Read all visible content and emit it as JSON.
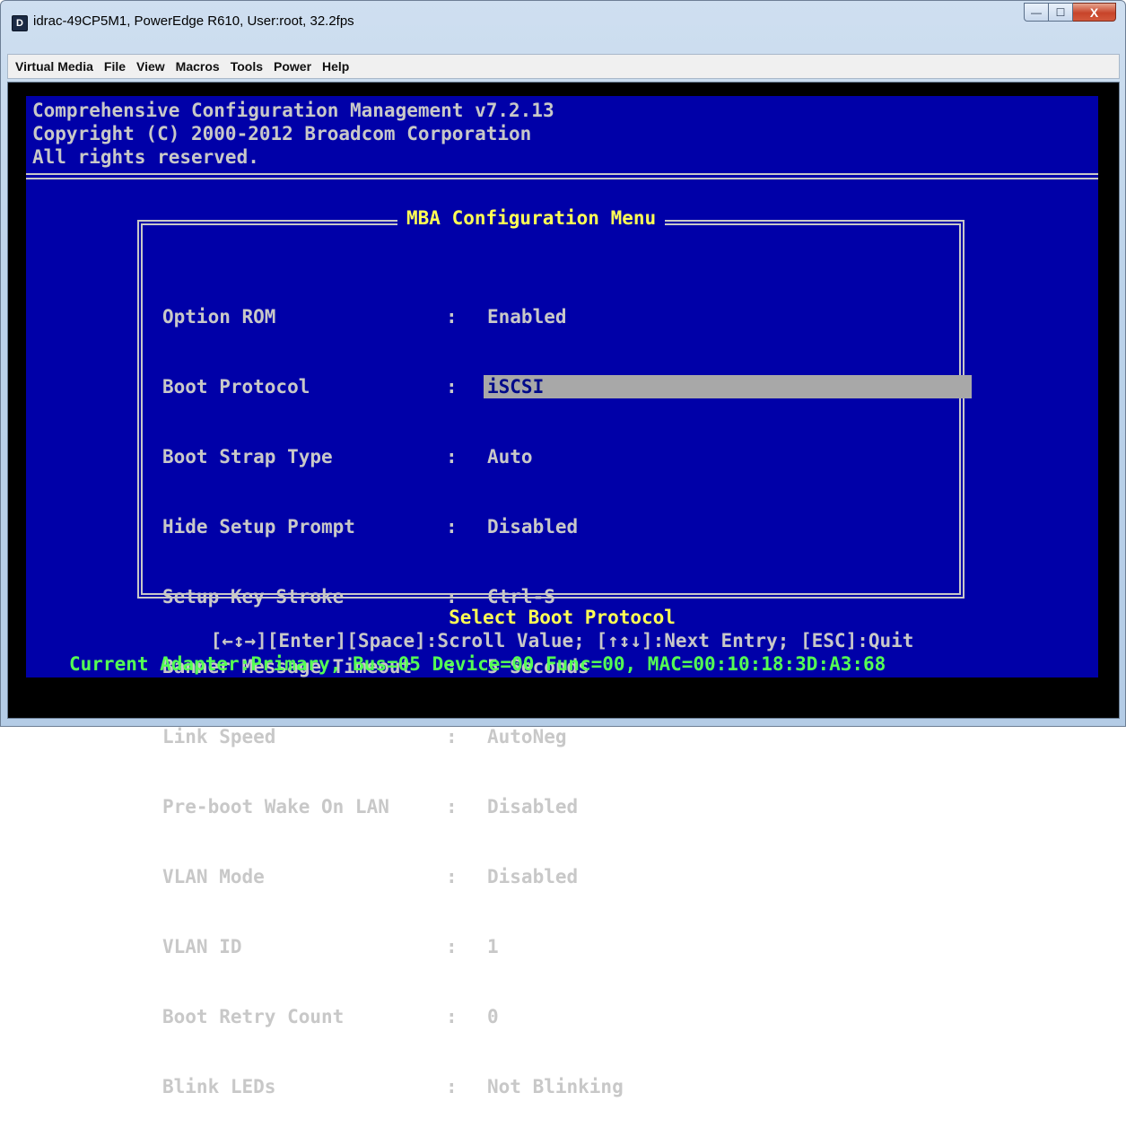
{
  "window": {
    "title": "idrac-49CP5M1, PowerEdge R610, User:root, 32.2fps",
    "app_icon": "D",
    "controls": {
      "minimize": "—",
      "maximize": "☐",
      "close": "X"
    }
  },
  "menubar": {
    "items": [
      "Virtual Media",
      "File",
      "View",
      "Macros",
      "Tools",
      "Power",
      "Help"
    ]
  },
  "console": {
    "header_lines": [
      "Comprehensive Configuration Management v7.2.13",
      "Copyright (C) 2000-2012 Broadcom Corporation",
      "All rights reserved."
    ],
    "menu_title": "MBA Configuration Menu",
    "separator": ":",
    "rows": [
      {
        "label": "Option ROM",
        "value": "Enabled"
      },
      {
        "label": "Boot Protocol",
        "value": "iSCSI"
      },
      {
        "label": "Boot Strap Type",
        "value": "Auto"
      },
      {
        "label": "Hide Setup Prompt",
        "value": "Disabled"
      },
      {
        "label": "Setup Key Stroke",
        "value": "Ctrl-S"
      },
      {
        "label": "Banner Message Timeout",
        "value": "5 Seconds"
      },
      {
        "label": "Link Speed",
        "value": "AutoNeg"
      },
      {
        "label": "Pre-boot Wake On LAN",
        "value": "Disabled"
      },
      {
        "label": "VLAN Mode",
        "value": "Disabled"
      },
      {
        "label": "VLAN ID",
        "value": "1"
      },
      {
        "label": "Boot Retry Count",
        "value": "0"
      },
      {
        "label": "Blink LEDs",
        "value": "Not Blinking"
      }
    ],
    "selected_row_label": "Boot Protocol",
    "select_help": "Select Boot Protocol",
    "keys_help": "[←↕→][Enter][Space]:Scroll Value; [↑↕↓]:Next Entry; [ESC]:Quit",
    "adapter_info": "Current Adapter:Primary, Bus=05 Device=00 Func=00, MAC=00:10:18:3D:A3:68"
  },
  "colors": {
    "console_bg": "#0000a8",
    "console_text": "#c8c8c8",
    "highlight_text": "#ffff54",
    "adapter_text": "#54ff54",
    "selection_bg": "#a8a8a8"
  }
}
